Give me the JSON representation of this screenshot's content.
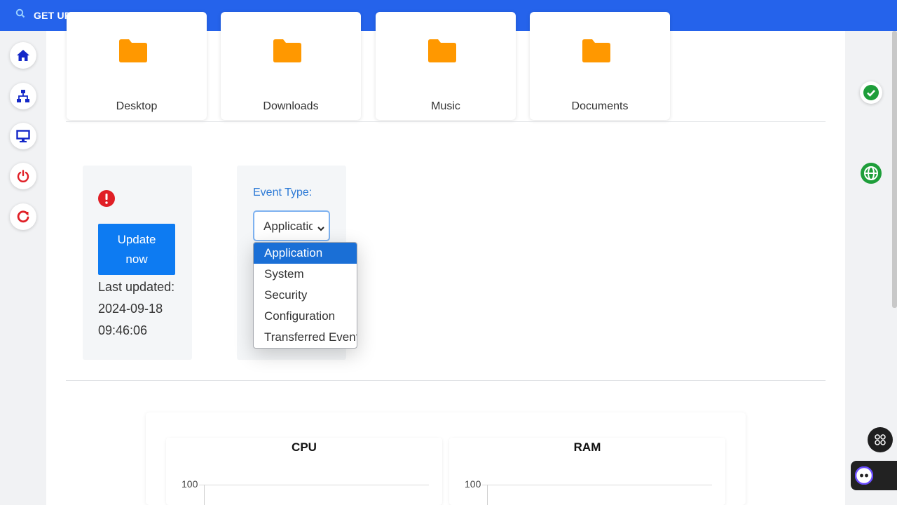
{
  "topbar": {
    "title": "GET UP",
    "search_icon": "search-icon"
  },
  "folders": [
    {
      "label": "Desktop",
      "icon": "folder-icon"
    },
    {
      "label": "Downloads",
      "icon": "folder-icon"
    },
    {
      "label": "Music",
      "icon": "folder-icon"
    },
    {
      "label": "Documents",
      "icon": "folder-icon"
    }
  ],
  "sidebar": [
    "home-icon",
    "network-icon",
    "monitor-icon",
    "power-icon",
    "refresh-icon"
  ],
  "update": {
    "button_label": "Update now",
    "last_updated_label": "Last updated:",
    "date": "2024-09-18",
    "time": "09:46:06"
  },
  "event_type": {
    "label": "Event Type:",
    "selected": "Application",
    "options": [
      "Application",
      "System",
      "Security",
      "Configuration",
      "Transferred Events"
    ]
  },
  "charts": [
    {
      "title": "CPU",
      "ymax_label": "100"
    },
    {
      "title": "RAM",
      "ymax_label": "100"
    }
  ],
  "colors": {
    "topbar": "#2563eb",
    "accent": "#0d7bf2",
    "folder": "#ff9800",
    "alert": "#e01f26",
    "success": "#1e9e3a"
  }
}
